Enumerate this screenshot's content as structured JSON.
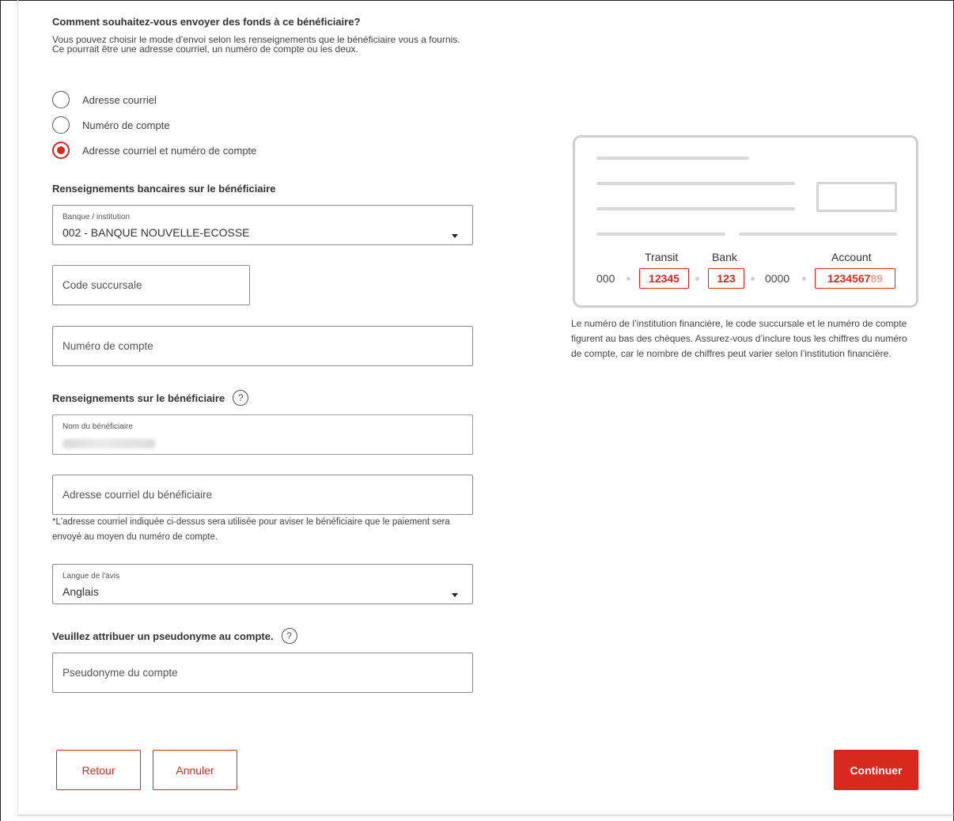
{
  "question": {
    "title": "Comment souhaitez-vous envoyer des fonds à ce bénéficiaire?",
    "description": "Vous pouvez choisir le mode d’envoi selon les renseignements que le bénéficiaire vous a fournis. Ce pourrait être une adresse courriel, un numéro de compte ou les deux."
  },
  "radio_options": [
    {
      "label": "Adresse courriel",
      "checked": false
    },
    {
      "label": "Numéro de compte",
      "checked": false
    },
    {
      "label": "Adresse courriel et numéro de compte",
      "checked": true
    }
  ],
  "bank_section": {
    "title": "Renseignements bancaires sur le bénéficiaire",
    "institution_label": "Banque / institution",
    "institution_value": "002 - BANQUE NOUVELLE-ECOSSE",
    "branch_placeholder": "Code succursale",
    "account_placeholder": "Numéro de compte"
  },
  "beneficiary_section": {
    "title": "Renseignements sur le bénéficiaire",
    "name_label": "Nom du bénéficiaire",
    "email_placeholder": "Adresse courriel du bénéficiaire",
    "email_note": "*L'adresse courriel indiquée ci-dessus sera utilisée pour aviser le bénéficiaire que le paiement sera envoyé au moyen du numéro de compte.",
    "language_label": "Langue de l'avis",
    "language_value": "Anglais"
  },
  "nickname_section": {
    "title": "Veuillez attribuer un pseudonyme au compte.",
    "placeholder": "Pseudonyme du compte"
  },
  "cheque": {
    "label_transit": "Transit",
    "label_bank": "Bank",
    "label_account": "Account",
    "prefix": "000",
    "transit": "12345",
    "bank": "123",
    "middle": "0000",
    "account_main": "1234567",
    "account_faded": "89",
    "note": "Le numéro de l’institution financière, le code succursale et le numéro de compte figurent au bas des chèques. Assurez-vous d’inclure tous les chiffres du numéro de compte, car le nombre de chiffres peut varier selon l’institution financière."
  },
  "buttons": {
    "back": "Retour",
    "cancel": "Annuler",
    "continue": "Continuer"
  },
  "colors": {
    "accent": "#d8291e"
  }
}
